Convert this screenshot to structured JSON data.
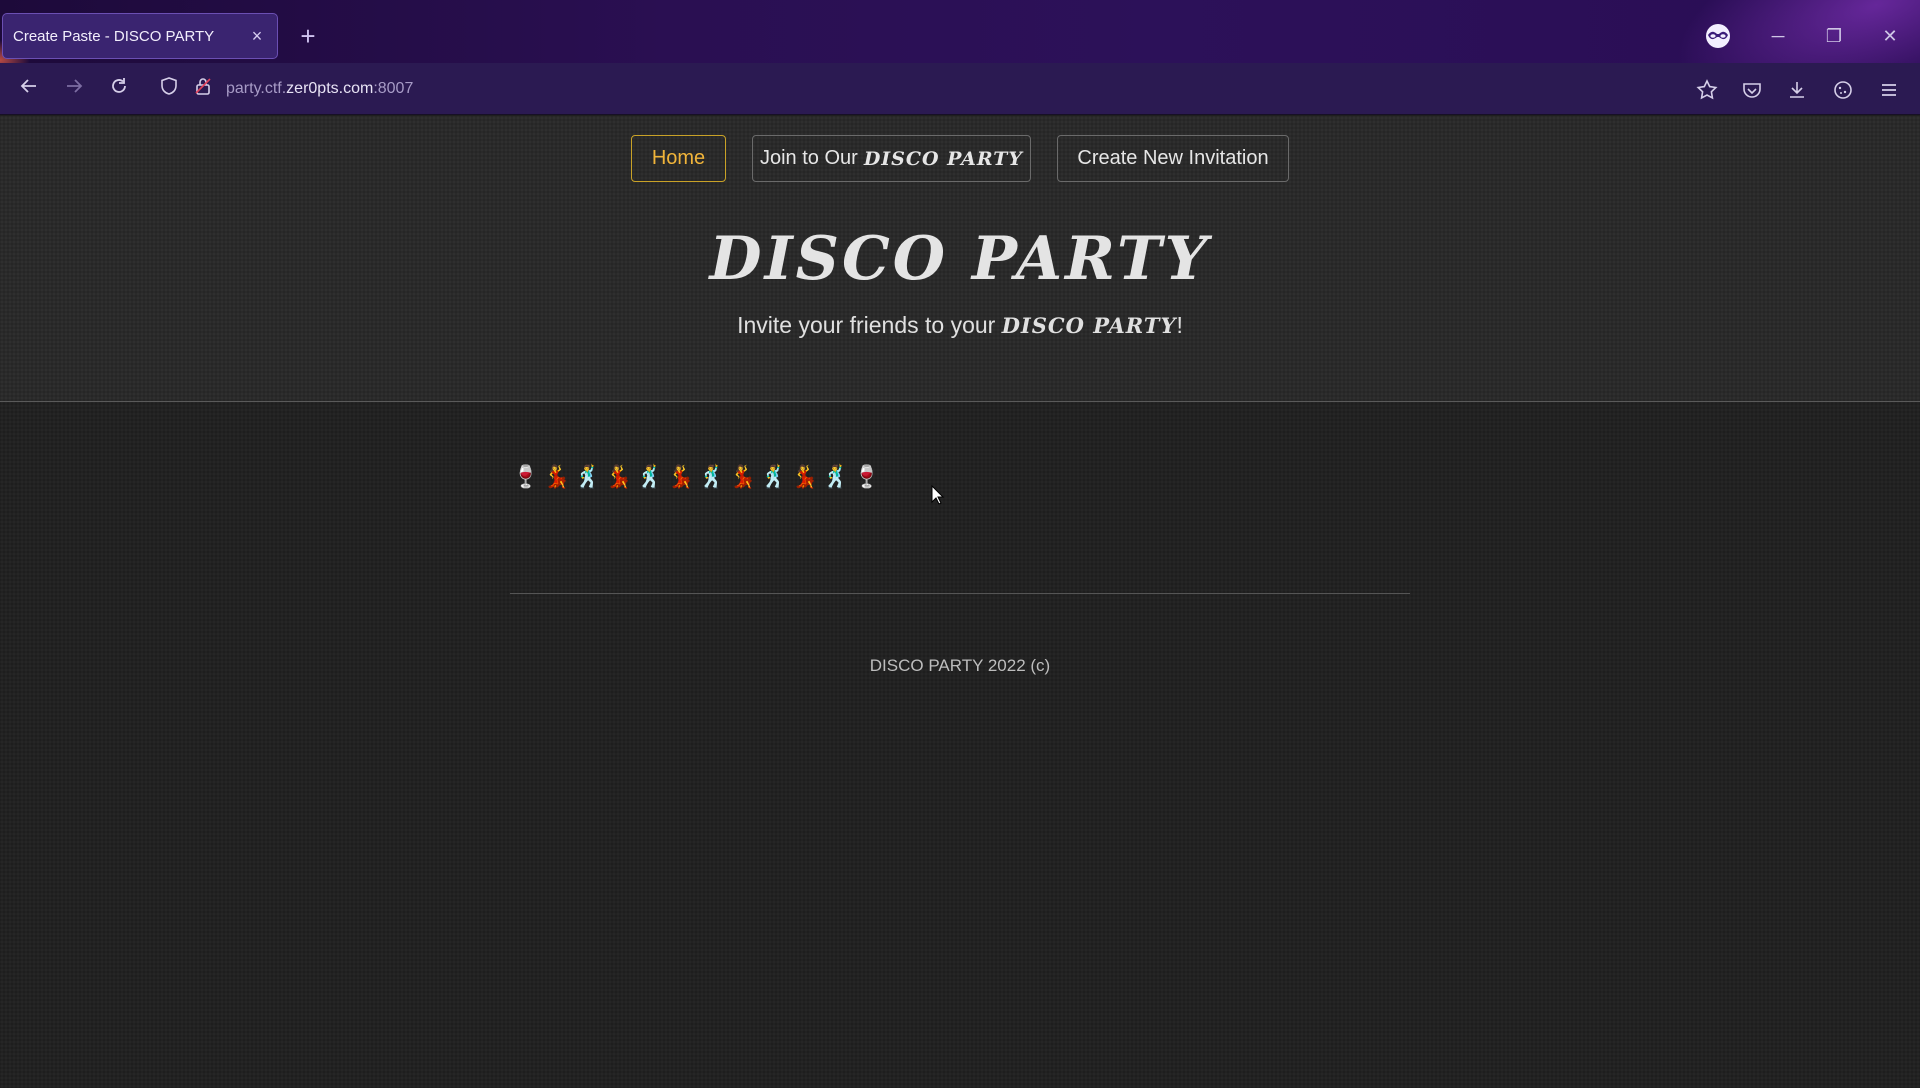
{
  "browser": {
    "tab_title": "Create Paste - DISCO PARTY",
    "tab_close": "×",
    "new_tab": "+",
    "url": {
      "prefix": "party.ctf.",
      "host": "zer0pts.com",
      "port": ":8007"
    },
    "window_controls": {
      "minimize": "─",
      "restore": "❐",
      "close": "✕"
    }
  },
  "nav": {
    "home_label": "Home",
    "join_label": "Join to Our",
    "join_brand": "DISCO PARTY",
    "create_label": "Create New Invitation"
  },
  "hero": {
    "title": "DISCO PARTY",
    "subtitle_prefix": "Invite your friends to your ",
    "subtitle_brand": "DISCO PARTY",
    "subtitle_suffix": "!"
  },
  "content": {
    "emojis": [
      "🍷",
      "💃",
      "🕺",
      "💃",
      "🕺",
      "💃",
      "🕺",
      "💃",
      "🕺",
      "💃",
      "🕺",
      "🍷"
    ]
  },
  "footer": {
    "text": "DISCO PARTY 2022 (c)"
  },
  "colors": {
    "accent": "#f0b43a",
    "chrome": "#2b1a52",
    "page_bg": "#222222"
  }
}
